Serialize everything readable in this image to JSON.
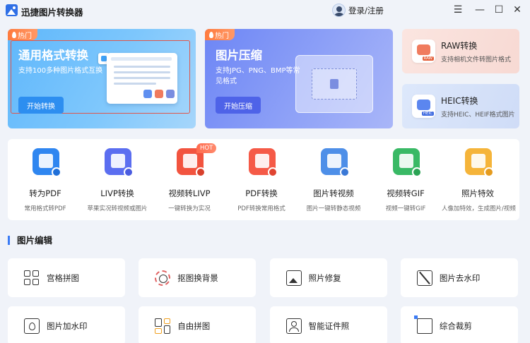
{
  "app": {
    "title": "迅捷图片转换器",
    "login_label": "登录/注册"
  },
  "window_controls": {
    "menu": "☰",
    "minimize": "—",
    "maximize": "☐",
    "close": "✕"
  },
  "banners": [
    {
      "hot_label": "热门",
      "title": "通用格式转换",
      "desc": "支持100多种图片格式互换",
      "button": "开始转换",
      "color": "#5fb7fb"
    },
    {
      "hot_label": "热门",
      "title": "图片压缩",
      "desc": "支持JPG、PNG、BMP等常见格式",
      "button": "开始压缩",
      "color": "#6d86f5"
    }
  ],
  "side_cards": [
    {
      "title": "RAW转换",
      "desc": "支持相机文件转图片格式",
      "tag": "RAW"
    },
    {
      "title": "HEIC转换",
      "desc": "支持HEIC、HEIF格式图片",
      "tag": "HEIC"
    }
  ],
  "tools": [
    {
      "name": "转为PDF",
      "desc": "常用格式转PDF",
      "icon": "pdf-convert-icon",
      "color": "#2f86f0",
      "corner": "#1f6fd8"
    },
    {
      "name": "LIVP转换",
      "desc": "苹果实况转视频或图片",
      "icon": "livp-icon",
      "color": "#5b6ef0",
      "corner": "#4a5ce0"
    },
    {
      "name": "视频转LIVP",
      "desc": "一键转换为实况",
      "icon": "video-livp-icon",
      "color": "#f2543f",
      "corner": "#d8402c",
      "hot": "HOT"
    },
    {
      "name": "PDF转换",
      "desc": "PDF转换常用格式",
      "icon": "pdf-icon",
      "color": "#f55a47",
      "corner": "#e04431"
    },
    {
      "name": "图片转视频",
      "desc": "图片一键转静态视频",
      "icon": "image-video-icon",
      "color": "#4e8fe8",
      "corner": "#3a78d6"
    },
    {
      "name": "视频转GIF",
      "desc": "视频一键转GIF",
      "icon": "gif-icon",
      "color": "#39b965",
      "corner": "#2aa354"
    },
    {
      "name": "照片特效",
      "desc": "人像加特效，生成图片/视频",
      "icon": "effects-icon",
      "color": "#f5b43a",
      "corner": "#e59b1e"
    }
  ],
  "section": {
    "title": "图片编辑"
  },
  "edit_tools": [
    {
      "label": "宫格拼图"
    },
    {
      "label": "抠图换背景"
    },
    {
      "label": "照片修复"
    },
    {
      "label": "图片去水印"
    },
    {
      "label": "图片加水印"
    },
    {
      "label": "自由拼图"
    },
    {
      "label": "智能证件照"
    },
    {
      "label": "综合裁剪"
    }
  ]
}
